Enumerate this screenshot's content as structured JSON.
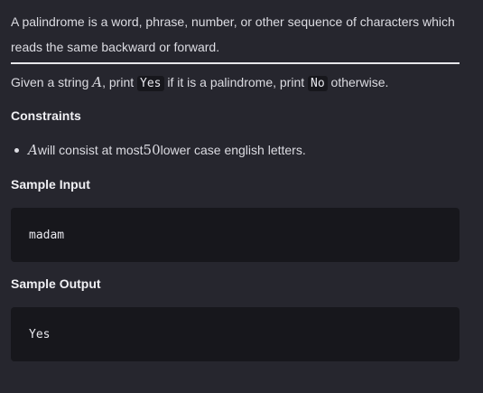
{
  "problem": {
    "intro_line1": "A palindrome is a word, phrase, number, or other sequence of characters which",
    "intro_line2": "reads the same backward or forward.",
    "statement": {
      "part1": "Given a string ",
      "var_a": "A",
      "part2": ", print ",
      "code_yes": "Yes",
      "part3": " if it is a palindrome, print ",
      "code_no": "No",
      "part4": " otherwise."
    },
    "constraints_heading": "Constraints",
    "constraints": {
      "item1": {
        "var": "A",
        "text1": " will consist at most ",
        "number": "50",
        "text2": " lower case english letters."
      }
    },
    "sample_input_heading": "Sample Input",
    "sample_input": "madam",
    "sample_output_heading": "Sample Output",
    "sample_output": "Yes"
  }
}
